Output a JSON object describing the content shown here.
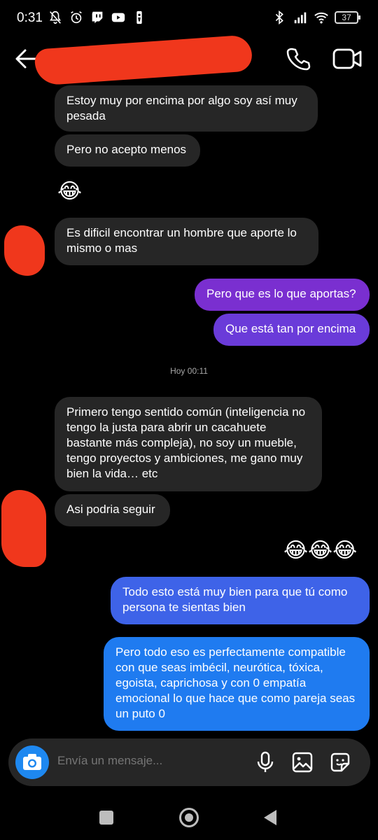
{
  "status_bar": {
    "time": "0:31",
    "battery": "37",
    "left_icons": [
      "mute-bell-icon",
      "alarm-icon",
      "twitch-icon",
      "youtube-icon",
      "nba-icon"
    ],
    "right_icons": [
      "bluetooth-icon",
      "signal-icon",
      "wifi-icon",
      "battery-icon"
    ]
  },
  "header": {
    "back_icon": "arrow-left-icon",
    "call_icon": "phone-icon",
    "video_icon": "video-camera-icon"
  },
  "messages": [
    {
      "side": "in",
      "text": "Estoy muy por encima por algo soy así muy pesada"
    },
    {
      "side": "in",
      "text": "Pero no acepto menos"
    },
    {
      "side": "in",
      "text": "😂"
    },
    {
      "side": "in",
      "text": "Es dificil encontrar un hombre que aporte lo mismo o mas"
    },
    {
      "side": "out",
      "text": "Pero que es lo que aportas?"
    },
    {
      "side": "out",
      "text": "Que está tan por encima"
    },
    {
      "side": "in",
      "text": "Primero tengo sentido común (inteligencia no tengo la justa para abrir un cacahuete bastante más compleja), no soy un mueble, tengo proyectos y ambiciones, me gano muy bien la vida…  etc"
    },
    {
      "side": "in",
      "text": "Asi podria seguir"
    },
    {
      "side": "out",
      "text": "😂😂😂"
    },
    {
      "side": "out",
      "text": "Todo esto está muy bien para que tú como persona te sientas bien"
    },
    {
      "side": "out",
      "text": "Pero todo eso es perfectamente compatible con que seas imbécil, neurótica, tóxica, egoista, caprichosa y con 0 empatía emocional lo que hace que como pareja seas un puto 0"
    }
  ],
  "timestamp": "Hoy 00:11",
  "composer": {
    "placeholder": "Envía un mensaje...",
    "camera_icon": "camera-icon",
    "mic_icon": "microphone-icon",
    "gallery_icon": "image-icon",
    "sticker_icon": "sticker-icon"
  },
  "colors": {
    "incoming_bubble": "#262626",
    "outgoing_purple": "#7a2fd0",
    "outgoing_blue": "#1f7bf0",
    "redaction": "#f0371c"
  }
}
